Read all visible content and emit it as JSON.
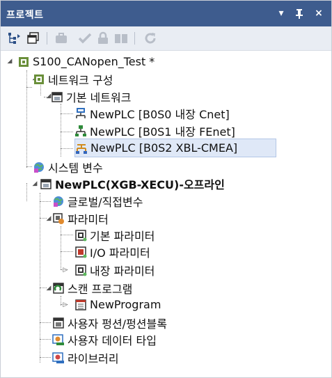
{
  "panel": {
    "title": "프로젝트",
    "controls": {
      "dropdown": "▾",
      "pin": "ᴘ",
      "close": "×"
    }
  },
  "toolbar": {
    "items": [
      "tree-view-icon",
      "window-icon",
      "briefcase-icon",
      "check-icon",
      "lock-icon",
      "book-icon",
      "refresh-icon"
    ]
  },
  "tree": {
    "project": "S100_CANopen_Test *",
    "network_config": "네트워크 구성",
    "basic_network": "기본 네트워크",
    "net1": "NewPLC [B0S0 내장 Cnet]",
    "net2": "NewPLC [B0S1 내장 FEnet]",
    "net3": "NewPLC [B0S2 XBL-CMEA]",
    "system_vars": "시스템 변수",
    "plc": "NewPLC(XGB-XECU)-오프라인",
    "global_vars": "글로벌/직접변수",
    "params": "파라미터",
    "basic_params": "기본 파라미터",
    "io_params": "I/O 파라미터",
    "internal_params": "내장 파라미터",
    "scan_programs": "스캔 프로그램",
    "new_program": "NewProgram",
    "user_fb": "사용자 펑션/펑션블록",
    "user_data_type": "사용자 데이터 타입",
    "library": "라이브러리"
  },
  "colors": {
    "titlebar": "#3e5c8e",
    "toolbar": "#e9edf3",
    "selection": "#dfe8f7"
  }
}
